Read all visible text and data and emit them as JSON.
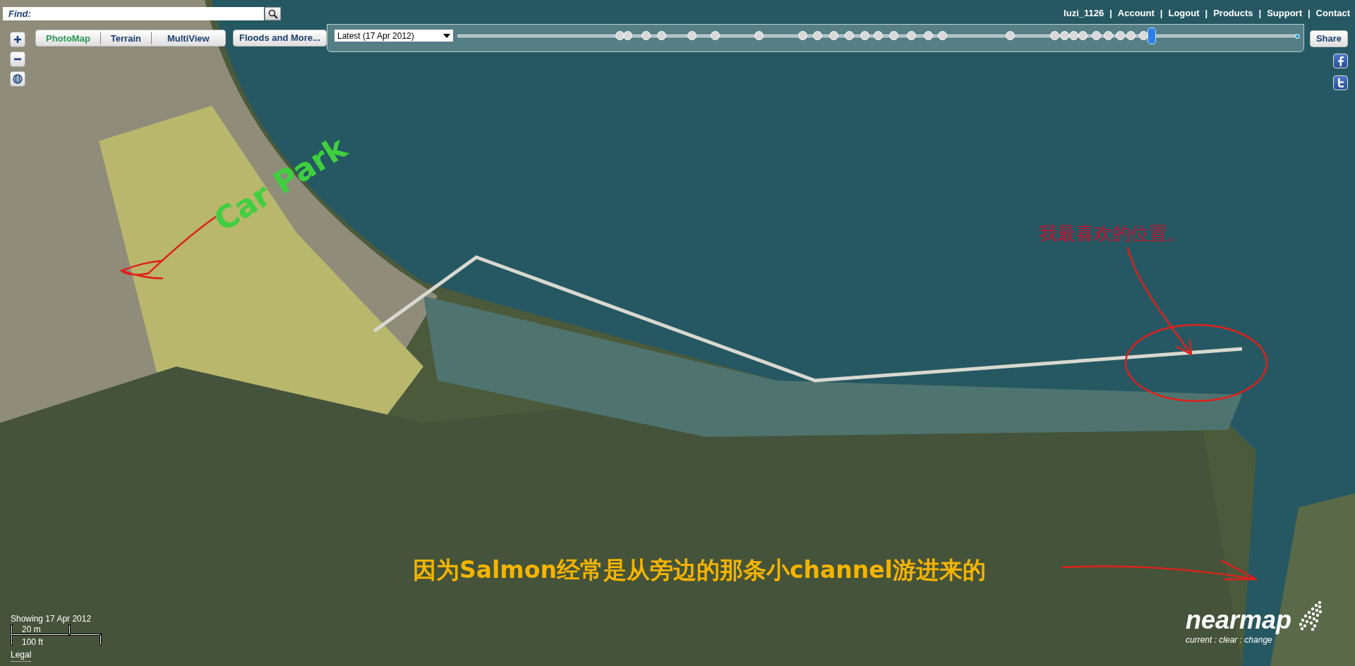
{
  "find": {
    "label": "Find:"
  },
  "view_tabs": [
    {
      "label": "PhotoMap",
      "selected": true
    },
    {
      "label": "Terrain",
      "selected": false
    },
    {
      "label": "MultiView",
      "selected": false
    }
  ],
  "floods_button": "Floods and More...",
  "timeline": {
    "dropdown": "Latest (17 Apr 2012)",
    "level": 0.827
  },
  "share_button": "Share",
  "user_links": {
    "separator": "|",
    "items": [
      "luzi_1126",
      "Account",
      "Logout",
      "Products",
      "Support",
      "Contact"
    ]
  },
  "scale": {
    "showing": "Showing 17 Apr 2012",
    "metric": "20 m",
    "imperial": "100 ft",
    "legal": "Legal"
  },
  "logo": {
    "name": "nearmap",
    "tagline": "current : clear : change"
  },
  "annotations": [
    {
      "kind": "label",
      "text": "Car Park",
      "color": "#3fcf3f"
    },
    {
      "kind": "arrow",
      "color": "#e0201c"
    },
    {
      "kind": "label",
      "text": "我最喜欢的位置。",
      "color": "#c8102e"
    },
    {
      "kind": "arrow",
      "color": "#e0201c"
    },
    {
      "kind": "ellipse",
      "color": "#e0201c"
    },
    {
      "kind": "label",
      "text": "因为Salmon经常是从旁边的那条小channel游进来的",
      "color": "#f5b400"
    },
    {
      "kind": "arrow",
      "color": "#e0201c"
    }
  ]
}
